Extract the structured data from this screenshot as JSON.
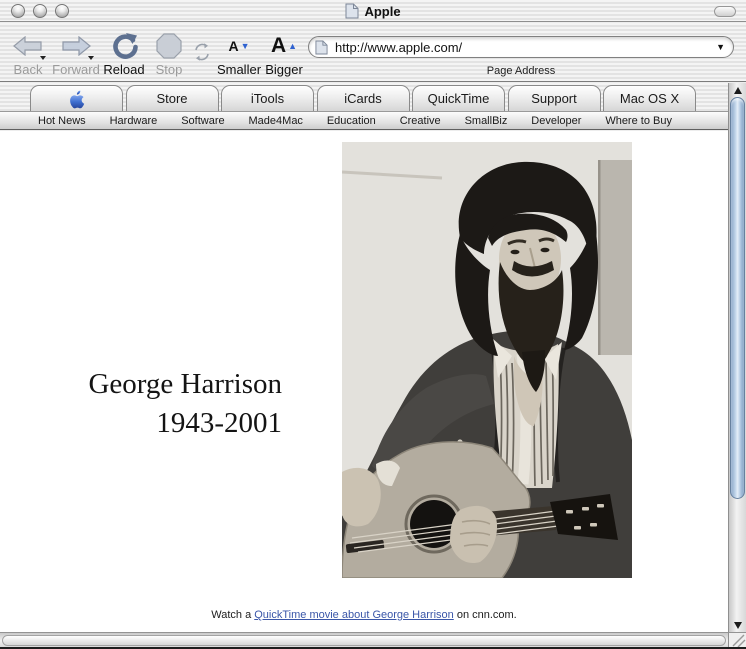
{
  "window": {
    "title": "Apple"
  },
  "toolbar": {
    "back_label": "Back",
    "forward_label": "Forward",
    "reload_label": "Reload",
    "stop_label": "Stop",
    "smaller_label": "Smaller",
    "bigger_label": "Bigger",
    "smaller_letter": "A",
    "bigger_letter": "A",
    "address_value": "http://www.apple.com/",
    "address_label": "Page Address"
  },
  "icons": {
    "smaller_arrow": "▼",
    "bigger_arrow": "▲",
    "address_dropdown": "▼"
  },
  "tabs": {
    "items": [
      {
        "label": "",
        "icon": "apple-logo",
        "active": true
      },
      {
        "label": "Store"
      },
      {
        "label": "iTools"
      },
      {
        "label": "iCards"
      },
      {
        "label": "QuickTime"
      },
      {
        "label": "Support"
      },
      {
        "label": "Mac OS X"
      }
    ]
  },
  "subnav": {
    "items": [
      "Hot News",
      "Hardware",
      "Software",
      "Made4Mac",
      "Education",
      "Creative",
      "SmallBiz",
      "Developer",
      "Where to Buy"
    ]
  },
  "content": {
    "headline": {
      "line1": "George Harrison",
      "line2": "1943-2001"
    },
    "photo": {
      "alt": "Black-and-white photo of George Harrison playing an acoustic guitar"
    },
    "footer": {
      "prefix": "Watch a ",
      "link_text": "QuickTime movie about George Harrison",
      "suffix": " on cnn.com."
    }
  },
  "colors": {
    "link": "#3a56a8",
    "accent_blue": "#2f62d0",
    "apple_logo_blue": "#3f6fd0",
    "aqua_thumb": "#c3d7ea",
    "disabled_label": "#9b9b9b"
  }
}
